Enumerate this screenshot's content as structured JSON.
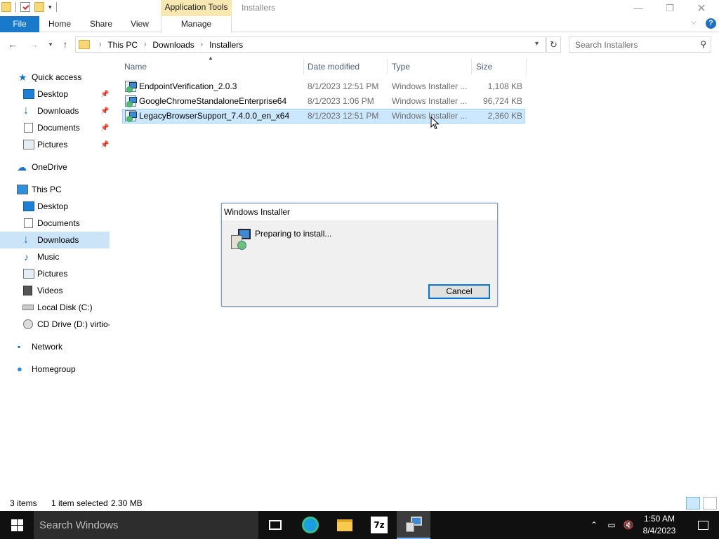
{
  "titlebar": {
    "context_tab": "Application Tools",
    "window_title": "Installers",
    "minimize": "—",
    "maximize": "❐",
    "close": "✕"
  },
  "ribbon": {
    "tabs": [
      "File",
      "Home",
      "Share",
      "View",
      "Manage"
    ],
    "help": "?"
  },
  "address": {
    "crumbs": [
      "This PC",
      "Downloads",
      "Installers"
    ],
    "search_placeholder": "Search Installers"
  },
  "navpane": {
    "items": [
      {
        "label": "Quick access",
        "icon": "star-icon"
      },
      {
        "label": "Desktop",
        "icon": "desktop-icon",
        "pinned": true
      },
      {
        "label": "Downloads",
        "icon": "downloads-icon",
        "pinned": true
      },
      {
        "label": "Documents",
        "icon": "documents-icon",
        "pinned": true
      },
      {
        "label": "Pictures",
        "icon": "pictures-icon",
        "pinned": true
      },
      {
        "label": "OneDrive",
        "icon": "cloud-icon"
      },
      {
        "label": "This PC",
        "icon": "computer-icon"
      },
      {
        "label": "Desktop",
        "icon": "desktop-icon"
      },
      {
        "label": "Documents",
        "icon": "documents-icon"
      },
      {
        "label": "Downloads",
        "icon": "downloads-icon",
        "selected": true
      },
      {
        "label": "Music",
        "icon": "music-icon"
      },
      {
        "label": "Pictures",
        "icon": "pictures-icon"
      },
      {
        "label": "Videos",
        "icon": "videos-icon"
      },
      {
        "label": "Local Disk (C:)",
        "icon": "disk-icon"
      },
      {
        "label": "CD Drive (D:) virtio-",
        "icon": "cd-drive-icon"
      },
      {
        "label": "Network",
        "icon": "network-icon"
      },
      {
        "label": "Homegroup",
        "icon": "homegroup-icon"
      }
    ]
  },
  "filelist": {
    "columns": [
      "Name",
      "Date modified",
      "Type",
      "Size"
    ],
    "rows": [
      {
        "name": "EndpointVerification_2.0.3",
        "date": "8/1/2023 12:51 PM",
        "type": "Windows Installer ...",
        "size": "1,108 KB"
      },
      {
        "name": "GoogleChromeStandaloneEnterprise64",
        "date": "8/1/2023 1:06 PM",
        "type": "Windows Installer ...",
        "size": "96,724 KB"
      },
      {
        "name": "LegacyBrowserSupport_7.4.0.0_en_x64",
        "date": "8/1/2023 12:51 PM",
        "type": "Windows Installer ...",
        "size": "2,360 KB",
        "selected": true
      }
    ]
  },
  "dialog": {
    "title": "Windows Installer",
    "message": "Preparing to install...",
    "cancel": "Cancel"
  },
  "status": {
    "count": "3 items",
    "selected": "1 item selected",
    "size": "2.30 MB"
  },
  "taskbar": {
    "search_placeholder": "Search Windows",
    "time": "1:50 AM",
    "date": "8/4/2023",
    "z7_label": "7z"
  },
  "colors": {
    "accent": "#1979ca",
    "selection": "#cce8ff",
    "nav_selection": "#cce4f7",
    "taskbar": "#101010"
  }
}
